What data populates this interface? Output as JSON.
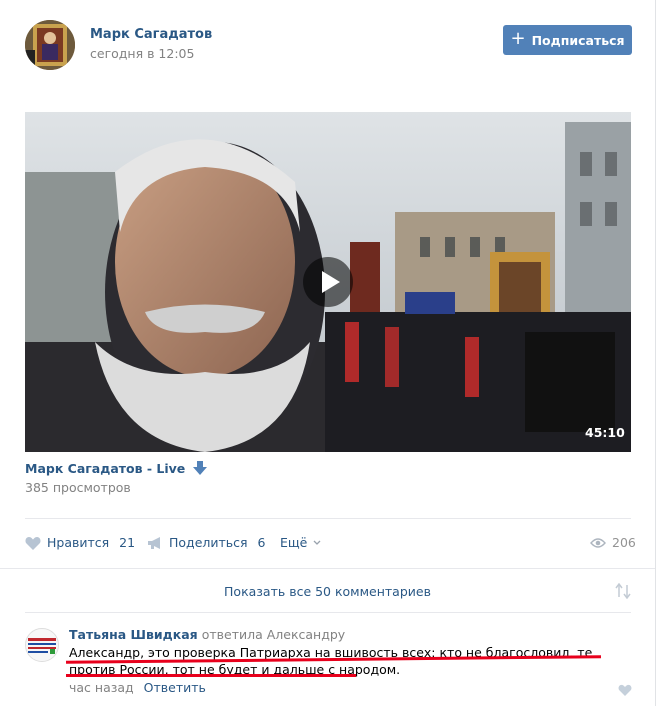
{
  "post": {
    "author": "Марк Сагадатов",
    "date": "сегодня в 12:05",
    "subscribe_label": "Подписаться"
  },
  "video": {
    "duration": "45:10",
    "title": "Марк Сагадатов - Live",
    "views": "385 просмотров"
  },
  "actions": {
    "like_label": "Нравится",
    "like_count": "21",
    "share_label": "Поделиться",
    "share_count": "6",
    "more_label": "Ещё",
    "views_count": "206"
  },
  "comments": {
    "show_all_label": "Показать все 50 комментариев",
    "items": [
      {
        "author": "Татьяна Швидкая",
        "reply_to": "ответила Александру",
        "text": "Александр, это проверка Патриарха на вшивость всех: кто не благословил, те против России, тот не будет и дальше с народом.",
        "time": "час назад",
        "reply_label": "Ответить"
      }
    ]
  },
  "colors": {
    "link": "#2a5885",
    "button": "#5181b8",
    "muted": "#828282",
    "underline": "#e8001c"
  }
}
